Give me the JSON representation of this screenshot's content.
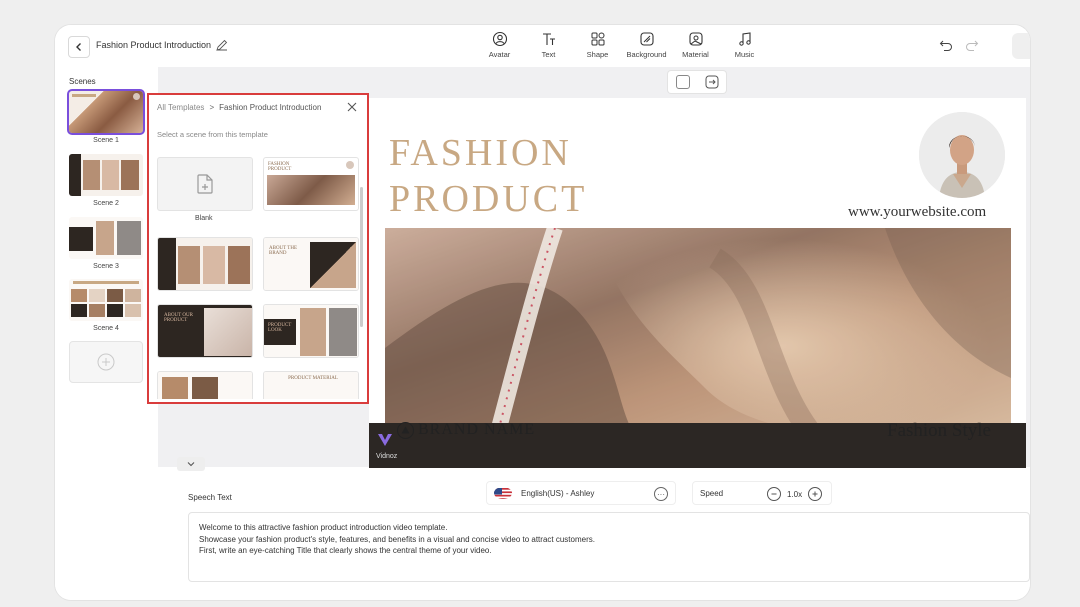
{
  "header": {
    "project_title": "Fashion Product Introduction",
    "tools": [
      {
        "label": "Avatar",
        "icon": "avatar-icon"
      },
      {
        "label": "Text",
        "icon": "text-icon"
      },
      {
        "label": "Shape",
        "icon": "shape-icon"
      },
      {
        "label": "Background",
        "icon": "background-icon"
      },
      {
        "label": "Material",
        "icon": "material-icon"
      },
      {
        "label": "Music",
        "icon": "music-icon"
      }
    ]
  },
  "scenes": {
    "title": "Scenes",
    "items": [
      {
        "label": "Scene 1",
        "active": true
      },
      {
        "label": "Scene 2",
        "active": false
      },
      {
        "label": "Scene 3",
        "active": false
      },
      {
        "label": "Scene 4",
        "active": false
      }
    ]
  },
  "templates": {
    "breadcrumb_root": "All Templates",
    "breadcrumb_separator": ">",
    "breadcrumb_current": "Fashion Product Introduction",
    "subtitle": "Select a scene from this template",
    "blank_label": "Blank",
    "thumb_texts": {
      "fashion": "FASHION PRODUCT",
      "about_brand": "ABOUT THE BRAND",
      "about_product": "ABOUT OUR PRODUCT",
      "product_look": "PRODUCT LOOK",
      "product_material": "PRODUCT MATERIAL"
    }
  },
  "slide": {
    "title": "FASHION\nPRODUCT",
    "website": "www.yourwebsite.com",
    "brand_name": "BRAND NAME",
    "tagline": "Fashion Style",
    "watermark": "Vidnoz"
  },
  "speech": {
    "label": "Speech Text",
    "voice": "English(US) - Ashley",
    "more": "···",
    "speed_label": "Speed",
    "speed_value": "1.0x",
    "lines": [
      "Welcome to this attractive fashion product introduction video template.",
      "Showcase your fashion product's style, features, and benefits in a visual and concise video to attract customers.",
      "First, write an eye-catching Title that clearly shows the central theme of your video."
    ]
  },
  "colors": {
    "accent": "#7a4fdc",
    "highlight_border": "#d93c3c",
    "title_gold": "#c8a883"
  }
}
